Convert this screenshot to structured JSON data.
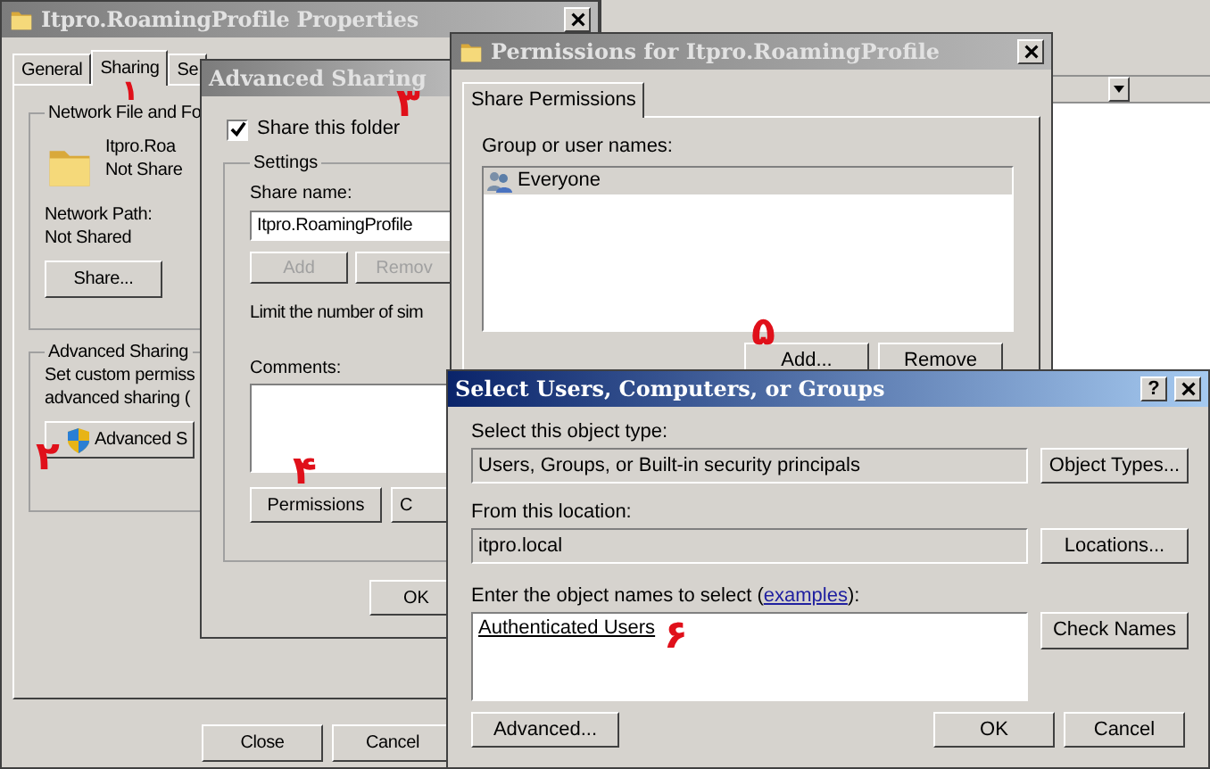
{
  "properties_window": {
    "title": "Itpro.RoamingProfile Properties",
    "active": false,
    "tabs": [
      {
        "label": "General",
        "selected": false
      },
      {
        "label": "Sharing",
        "selected": true
      },
      {
        "label": "Se",
        "selected": false
      }
    ],
    "network_group": {
      "title": "Network File and Fo",
      "folder_name": "Itpro.Roa",
      "folder_status": "Not Share",
      "path_label": "Network Path:",
      "path_value": "Not Shared",
      "button": "Share..."
    },
    "advanced_group": {
      "title": "Advanced Sharing",
      "description": [
        "Set custom permiss",
        "advanced sharing ("
      ],
      "button": "Advanced S"
    },
    "buttons": [
      "Close",
      "Cancel"
    ]
  },
  "advanced_sharing_window": {
    "title": "Advanced Sharing",
    "active": false,
    "share_checkbox": {
      "label": "Share this folder",
      "checked": true
    },
    "settings": {
      "title": "Settings",
      "share_name_label": "Share name:",
      "share_name_value": "Itpro.RoamingProfile",
      "buttons": [
        {
          "label": "Add",
          "disabled": true
        },
        {
          "label": "Remov",
          "disabled": true
        }
      ],
      "limit_text": "Limit the number of sim",
      "comments_label": "Comments:",
      "permissions_button": "Permissions",
      "caching_button": "C"
    },
    "ok_button": "OK"
  },
  "permissions_window": {
    "title": "Permissions for Itpro.RoamingProfile",
    "active": false,
    "tabs": [
      {
        "label": "Share Permissions",
        "selected": true
      }
    ],
    "group_label": "Group or user names:",
    "users": [
      {
        "name": "Everyone",
        "selected": true
      }
    ],
    "buttons": [
      "Add...",
      "Remove"
    ]
  },
  "select_dialog": {
    "title": "Select Users, Computers, or Groups",
    "active": true,
    "help_button": "?",
    "object_type_label": "Select this object type:",
    "object_type_value": "Users, Groups, or Built-in security principals",
    "object_types_button": "Object Types...",
    "location_label": "From this location:",
    "location_value": "itpro.local",
    "locations_button": "Locations...",
    "names_label": {
      "before": "Enter the object names to select (",
      "link": "examples",
      "after": "):"
    },
    "names_value": "Authenticated Users",
    "check_names_button": "Check Names",
    "buttons": [
      "Advanced...",
      "OK",
      "Cancel"
    ]
  },
  "annotations": [
    "۱",
    "۲",
    "۳",
    "۴",
    "۵",
    "۶"
  ]
}
